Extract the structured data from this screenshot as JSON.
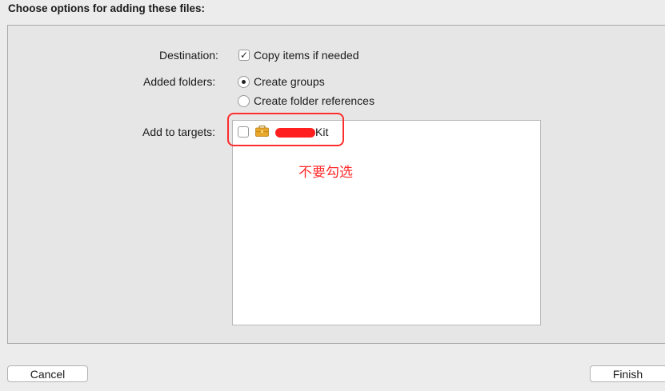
{
  "dialog": {
    "header": "Choose options for adding these files:"
  },
  "destination": {
    "label": "Destination:",
    "option_label": "Copy items if needed",
    "checked": true
  },
  "added_folders": {
    "label": "Added folders:",
    "options": [
      {
        "label": "Create groups",
        "selected": true
      },
      {
        "label": "Create folder references",
        "selected": false
      }
    ]
  },
  "targets": {
    "label": "Add to targets:",
    "items": [
      {
        "label_visible": "Kit",
        "checked": false,
        "icon": "toolbox-icon",
        "name_redacted": true
      }
    ]
  },
  "annotation": {
    "text": "不要勾选",
    "color": "#ff2d2d"
  },
  "buttons": {
    "cancel": "Cancel",
    "finish": "Finish"
  }
}
